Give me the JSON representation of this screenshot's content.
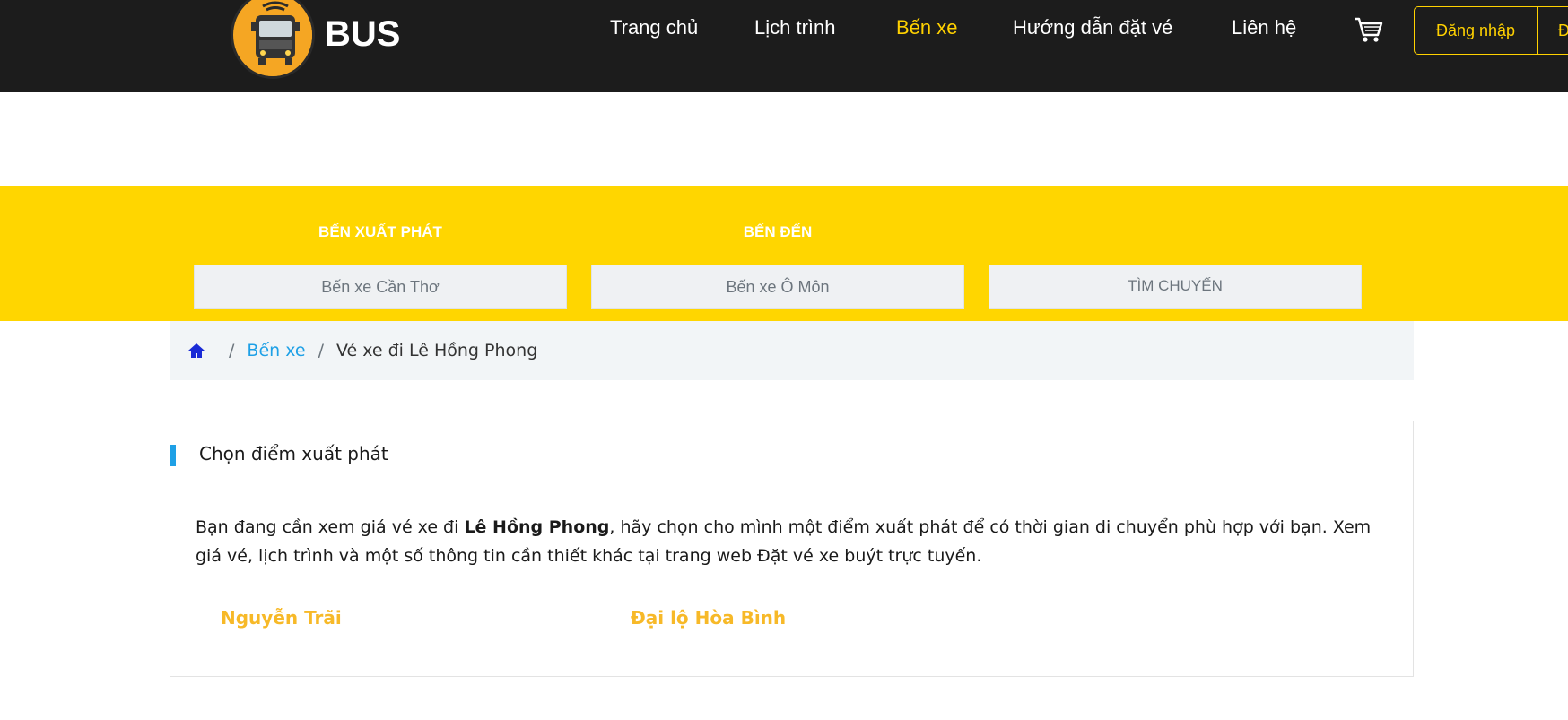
{
  "header": {
    "brand": "BUS",
    "nav": [
      "Trang chủ",
      "Lịch trình",
      "Bến xe",
      "Hướng dẫn đặt vé",
      "Liên hệ"
    ],
    "active_nav": "Bến xe",
    "login_label": "Đăng nhập",
    "register_label": "Đ"
  },
  "search": {
    "from_label": "BẾN XUẤT PHÁT",
    "to_label": "BẾN ĐẾN",
    "from_value": "Bến xe Cần Thơ",
    "to_value": "Bến xe Ô Môn",
    "button_label": "TÌM CHUYẾN"
  },
  "breadcrumb": {
    "link": "Bến xe",
    "current": "Vé xe đi Lê Hồng Phong"
  },
  "card": {
    "title": "Chọn điểm xuất phát",
    "text_before": "Bạn đang cần xem giá vé xe đi ",
    "text_bold": "Lê Hồng Phong",
    "text_after": ", hãy chọn cho mình một điểm xuất phát để có thời gian di chuyển phù hợp với bạn. Xem giá vé, lịch trình và một số thông tin cần thiết khác tại trang web Đặt vé xe buýt trực tuyến.",
    "stops": [
      "Nguyễn Trãi",
      "Đại lộ Hòa Bình"
    ]
  },
  "colors": {
    "header_bg": "#1c1c1c",
    "accent_yellow": "#ffd600",
    "link_blue": "#1ea0e6",
    "stop_orange": "#f7b928"
  },
  "icons": [
    "bus-logo-icon",
    "cart-icon",
    "home-icon"
  ]
}
